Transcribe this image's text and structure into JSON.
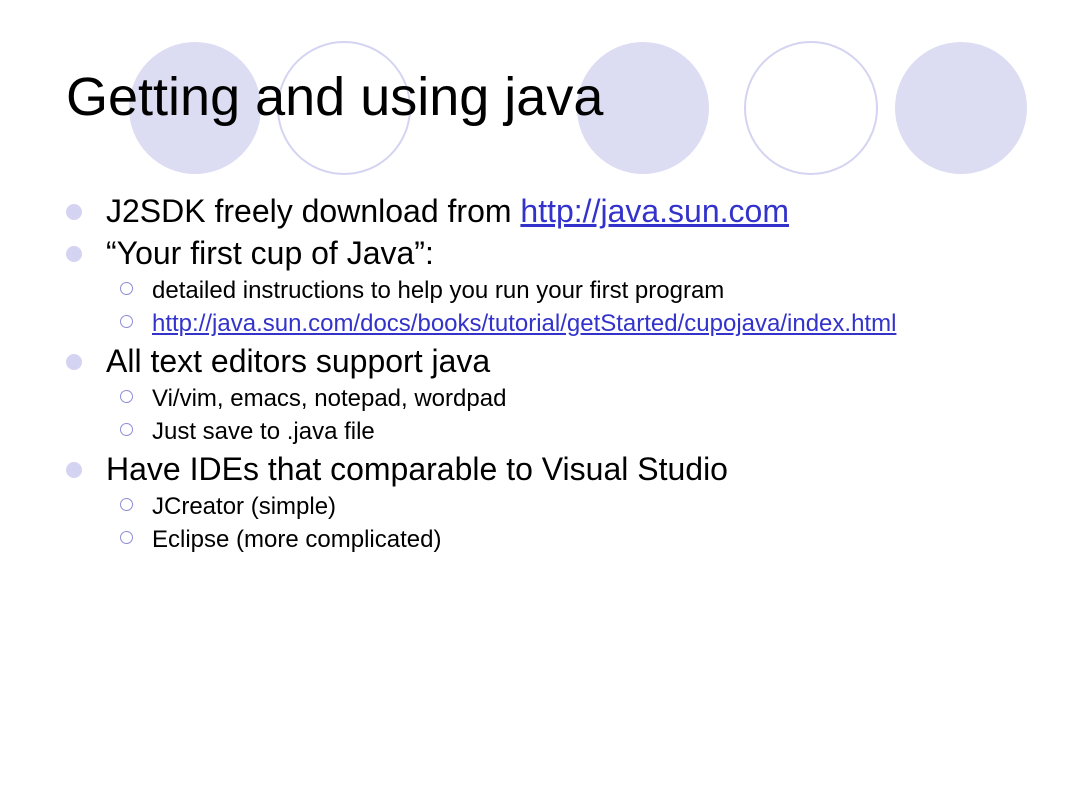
{
  "slide": {
    "title": "Getting and using java",
    "bullets": [
      {
        "text": "J2SDK freely download from ",
        "link": "http://java.sun.com"
      },
      {
        "text": "“Your first cup of Java”:",
        "sub": [
          {
            "text": "detailed instructions to help you run your first program"
          },
          {
            "link": "http://java.sun.com/docs/books/tutorial/getStarted/cupojava/index.html"
          }
        ]
      },
      {
        "text": "All text editors support java",
        "sub": [
          {
            "text": "Vi/vim, emacs, notepad, wordpad"
          },
          {
            "text": "Just save to .java file"
          }
        ]
      },
      {
        "text": "Have IDEs that comparable to Visual Studio",
        "sub": [
          {
            "text": "JCreator (simple)"
          },
          {
            "text": "Eclipse (more complicated)"
          }
        ]
      }
    ]
  },
  "colors": {
    "circle_fill": "#dcdcf3",
    "circle_outline": "#d4d4f2",
    "bullet_l1": "#d4d4f2",
    "bullet_l2_outline": "#8f8fd8",
    "link": "#3333cc"
  }
}
